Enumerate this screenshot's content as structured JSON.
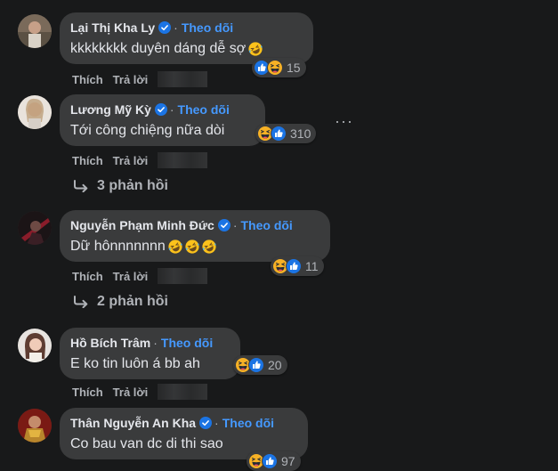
{
  "comments": [
    {
      "name": "Lại Thị Kha Ly",
      "follow": "Theo dõi",
      "text": "kkkkkkkk duyên dáng dễ sợ",
      "react_count": "15",
      "like": "Thích",
      "reply": "Trả lời"
    },
    {
      "name": "Lương Mỹ Kỳ",
      "follow": "Theo dõi",
      "text": "Tới công chiệng nữa dòi",
      "react_count": "310",
      "like": "Thích",
      "reply": "Trả lời",
      "replies": "3 phản hồi"
    },
    {
      "name": "Nguyễn Phạm Minh Đức",
      "follow": "Theo dõi",
      "text": "Dữ hônnnnnnn",
      "react_count": "11",
      "like": "Thích",
      "reply": "Trả lời",
      "replies": "2 phản hồi"
    },
    {
      "name": "Hồ Bích Trâm",
      "follow": "Theo dõi",
      "text": "E ko tin luôn á bb ah",
      "react_count": "20",
      "like": "Thích",
      "reply": "Trả lời"
    },
    {
      "name": "Thân Nguyễn An Kha",
      "follow": "Theo dõi",
      "text": "Co bau van dc di thi sao",
      "react_count": "97"
    }
  ],
  "more_menu": "···",
  "colors": {
    "background": "#18191a",
    "bubble": "#3a3b3c",
    "follow": "#4599ff",
    "text": "#e4e6eb",
    "muted": "#b0b3b8"
  }
}
